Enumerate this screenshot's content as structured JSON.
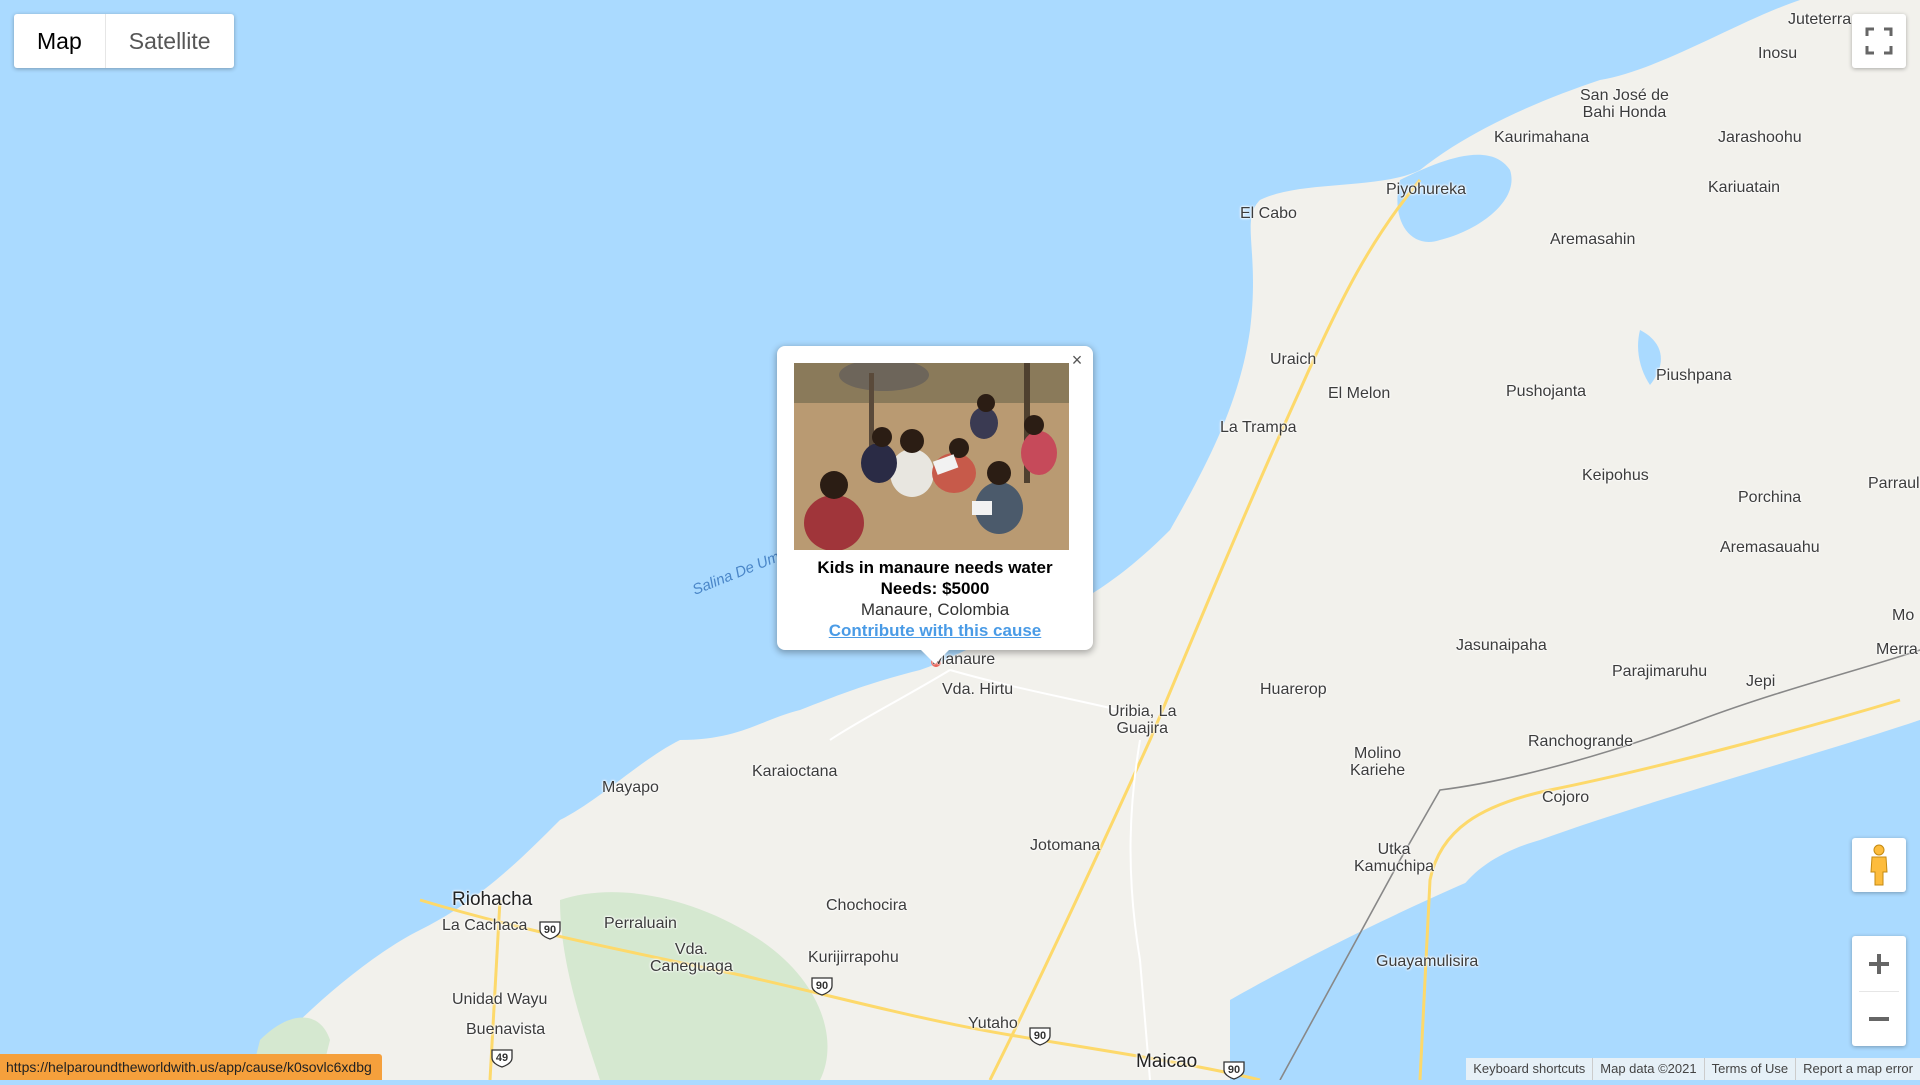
{
  "map_type": {
    "map_label": "Map",
    "satellite_label": "Satellite"
  },
  "places": [
    {
      "id": "juteterra",
      "label": "Juteterra"
    },
    {
      "id": "inosu",
      "label": "Inosu"
    },
    {
      "id": "san-jose",
      "label": "San José de\nBahi Honda"
    },
    {
      "id": "kaurimahana",
      "label": "Kaurimahana"
    },
    {
      "id": "jarashoohu",
      "label": "Jarashoohu"
    },
    {
      "id": "piyohureka",
      "label": "Piyohureka"
    },
    {
      "id": "kariuatain",
      "label": "Kariuatain"
    },
    {
      "id": "el-cabo",
      "label": "El Cabo"
    },
    {
      "id": "aremasahin",
      "label": "Aremasahin"
    },
    {
      "id": "uraich",
      "label": "Uraich"
    },
    {
      "id": "el-melon",
      "label": "El Melon"
    },
    {
      "id": "pushojanta",
      "label": "Pushojanta"
    },
    {
      "id": "piushpana",
      "label": "Piushpana"
    },
    {
      "id": "la-trampa",
      "label": "La Trampa"
    },
    {
      "id": "keipohus",
      "label": "Keipohus"
    },
    {
      "id": "porchina",
      "label": "Porchina"
    },
    {
      "id": "parraul",
      "label": "Parraul"
    },
    {
      "id": "aremasauahu",
      "label": "Aremasauahu"
    },
    {
      "id": "mo",
      "label": "Mo"
    },
    {
      "id": "jasunaipaha",
      "label": "Jasunaipaha"
    },
    {
      "id": "merra",
      "label": "Merra"
    },
    {
      "id": "parajimaruhu",
      "label": "Parajimaruhu"
    },
    {
      "id": "jepi",
      "label": "Jepi"
    },
    {
      "id": "manaure",
      "label": "Manaure"
    },
    {
      "id": "vda-hirtu",
      "label": "Vda. Hirtu"
    },
    {
      "id": "uribia",
      "label": "Uribia, La\nGuajira"
    },
    {
      "id": "huarerop",
      "label": "Huarerop"
    },
    {
      "id": "molino",
      "label": "Molino\nKariehe"
    },
    {
      "id": "ranchogrande",
      "label": "Ranchogrande"
    },
    {
      "id": "cojoro",
      "label": "Cojoro"
    },
    {
      "id": "mayapo",
      "label": "Mayapo"
    },
    {
      "id": "karaioctana",
      "label": "Karaioctana"
    },
    {
      "id": "jotomana",
      "label": "Jotomana"
    },
    {
      "id": "utka",
      "label": "Utka\nKamuchipa"
    },
    {
      "id": "riohacha",
      "label": "Riohacha"
    },
    {
      "id": "la-cachaca",
      "label": "La Cachaca"
    },
    {
      "id": "perralain",
      "label": "Perraluain"
    },
    {
      "id": "chochocira",
      "label": "Chochocira"
    },
    {
      "id": "vda-caneguaga",
      "label": "Vda.\nCaneguaga"
    },
    {
      "id": "kurijirrapohu",
      "label": "Kurijirrapohu"
    },
    {
      "id": "guayamulisira",
      "label": "Guayamulisira"
    },
    {
      "id": "unidad-wayu",
      "label": "Unidad Wayu"
    },
    {
      "id": "buenavista",
      "label": "Buenavista"
    },
    {
      "id": "yutaho",
      "label": "Yutaho"
    },
    {
      "id": "maicao",
      "label": "Maicao"
    },
    {
      "id": "salina",
      "label": "Salina De Um"
    }
  ],
  "route_shields": [
    "90",
    "90",
    "90",
    "90",
    "49"
  ],
  "info_window": {
    "title": "Kids in manaure needs water",
    "needs": "Needs: $5000",
    "location": "Manaure, Colombia",
    "link_label": "Contribute with this cause",
    "close_symbol": "×"
  },
  "footer": {
    "keyboard": "Keyboard shortcuts",
    "map_data": "Map data ©2021",
    "terms": "Terms of Use",
    "report": "Report a map error"
  },
  "status_url": "https://helparoundtheworldwith.us/app/cause/k0sovlc6xdbg",
  "colors": {
    "water": "#aadaff",
    "land": "#f2f1ec",
    "road": "#fdd96b",
    "link": "#4a9be6",
    "status": "#f5a03c"
  }
}
